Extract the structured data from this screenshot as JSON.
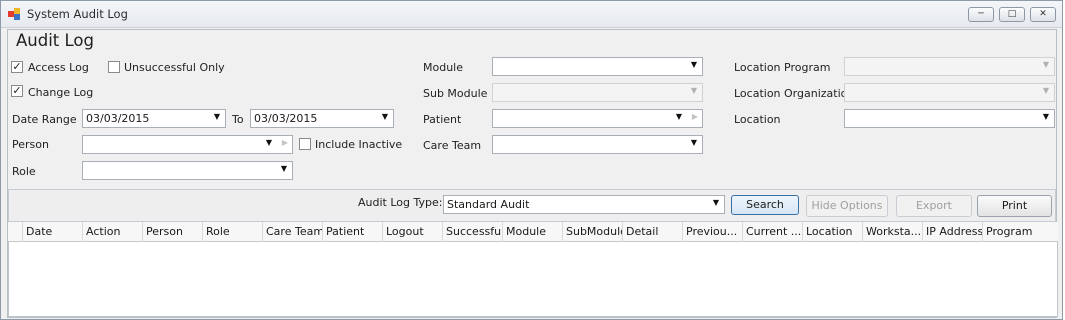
{
  "window": {
    "title": "System Audit Log",
    "controls": {
      "minimize": "─",
      "maximize": "□",
      "close": "✕"
    }
  },
  "heading": "Audit Log",
  "filters": {
    "access_log": {
      "label": "Access Log",
      "checked": true
    },
    "unsuccessful_only": {
      "label": "Unsuccessful Only",
      "checked": false
    },
    "change_log": {
      "label": "Change Log",
      "checked": true
    },
    "date_range": {
      "label": "Date Range",
      "from": "03/03/2015",
      "to_label": "To",
      "to": "03/03/2015"
    },
    "person": {
      "label": "Person",
      "value": ""
    },
    "include_inactive": {
      "label": "Include Inactive",
      "checked": false
    },
    "role": {
      "label": "Role",
      "value": ""
    },
    "module": {
      "label": "Module",
      "value": ""
    },
    "sub_module": {
      "label": "Sub Module",
      "value": ""
    },
    "patient": {
      "label": "Patient",
      "value": ""
    },
    "care_team": {
      "label": "Care Team",
      "value": ""
    },
    "location_program": {
      "label": "Location Program",
      "value": ""
    },
    "location_organization": {
      "label": "Location Organization",
      "value": ""
    },
    "location": {
      "label": "Location",
      "value": ""
    }
  },
  "toolbar": {
    "audit_log_type_label": "Audit Log Type:",
    "audit_log_type_value": "Standard Audit",
    "search": "Search",
    "hide_options": "Hide Options",
    "export": "Export",
    "print": "Print"
  },
  "grid": {
    "columns": [
      "Date",
      "Action",
      "Person",
      "Role",
      "Care Team",
      "Patient",
      "Logout",
      "Successful",
      "Module",
      "SubModule",
      "Detail",
      "Previou...",
      "Current ...",
      "Location",
      "Worksta...",
      "IP Address",
      "Program"
    ],
    "rows": []
  },
  "icons": {
    "app": "app-icon",
    "dropdown": "chevron-down-icon",
    "lookup": "triangle-right-icon",
    "check": "checkmark-icon"
  },
  "colors": {
    "window_bg": "#f0f0f0",
    "focus_border": "#3c6ea8"
  }
}
